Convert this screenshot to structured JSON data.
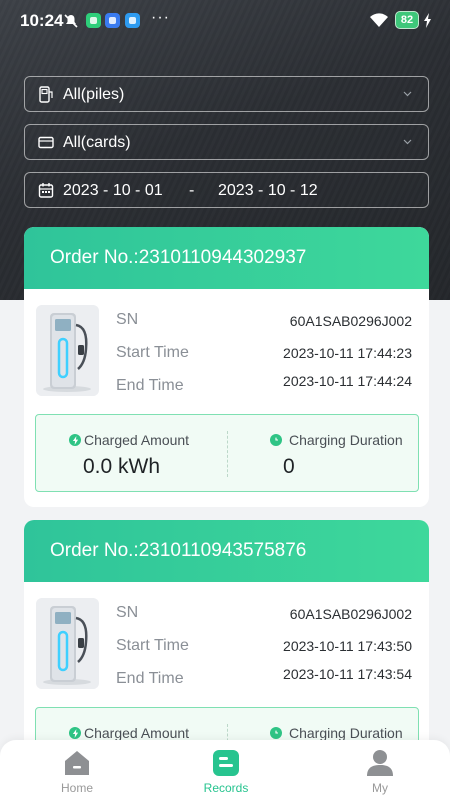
{
  "status_bar": {
    "time": "10:24",
    "more": "···",
    "battery": "82"
  },
  "filters": {
    "piles": "All(piles)",
    "cards": "All(cards)",
    "date_from": "2023 - 10 - 01",
    "date_separator": "-",
    "date_to": "2023 - 10 - 12"
  },
  "labels": {
    "sn": "SN",
    "start_time": "Start Time",
    "end_time": "End Time",
    "charged_amount": "Charged Amount",
    "charging_duration": "Charging Duration"
  },
  "records": [
    {
      "order": "Order No.:2310110944302937",
      "sn": "60A1SAB0296J002",
      "start_time": "2023-10-11 17:44:23",
      "end_time": "2023-10-11 17:44:24",
      "charged_amount": "0.0 kWh",
      "charging_duration": "0"
    },
    {
      "order": "Order No.:2310110943575876",
      "sn": "60A1SAB0296J002",
      "start_time": "2023-10-11 17:43:50",
      "end_time": "2023-10-11 17:43:54",
      "charged_amount": "",
      "charging_duration": ""
    }
  ],
  "nav": {
    "home": "Home",
    "records": "Records",
    "my": "My",
    "active": "records"
  },
  "colors": {
    "accent": "#2fc49a",
    "header_bg": "#2b2e33"
  },
  "icons": {
    "filter_piles": "charging-pile-icon",
    "filter_cards": "card-icon",
    "filter_date": "calendar-icon",
    "charged_amount": "bolt-icon",
    "charging_duration": "clock-icon"
  }
}
